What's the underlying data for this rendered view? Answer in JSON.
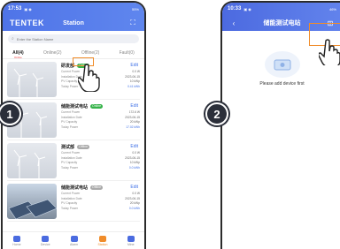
{
  "screen1": {
    "status_time": "17:53",
    "status_right": "55%",
    "logo": "TENTEK",
    "title": "Station",
    "search_placeholder": "Enter the Station Name",
    "tabs": [
      {
        "label": "All(4)",
        "sub": "Online"
      },
      {
        "label": "Online(2)"
      },
      {
        "label": "Offline(2)"
      },
      {
        "label": "Fault(0)"
      }
    ],
    "stations": [
      {
        "name": "研发部",
        "badge": "Online",
        "edit": "Edit",
        "rows": [
          [
            "Current Power",
            "0.0 W"
          ],
          [
            "Installation Date",
            "2023-06-15"
          ],
          [
            "PV Capacity",
            "10 kWp"
          ],
          [
            "Today Power",
            "0.41 kWh"
          ]
        ]
      },
      {
        "name": "储能测试电站",
        "badge": "Online",
        "edit": "Edit",
        "rows": [
          [
            "Current Power",
            "172.6 W"
          ],
          [
            "Installation Date",
            "2023-06-15"
          ],
          [
            "PV Capacity",
            "20 kWp"
          ],
          [
            "Today Power",
            "17.02 kWh"
          ]
        ]
      },
      {
        "name": "测试部",
        "badge": "Offline",
        "edit": "Edit",
        "rows": [
          [
            "Current Power",
            "0.0 W"
          ],
          [
            "Installation Date",
            "2023-06-15"
          ],
          [
            "PV Capacity",
            "10 kWp"
          ],
          [
            "Today Power",
            "0.0 kWh"
          ]
        ]
      },
      {
        "name": "储能测试电站",
        "badge": "Offline",
        "edit": "Edit",
        "rows": [
          [
            "Current Power",
            "0.0 W"
          ],
          [
            "Installation Date",
            "2023-06-15"
          ],
          [
            "PV Capacity",
            "20 kWp"
          ],
          [
            "Today Power",
            "0.0 kWh"
          ]
        ]
      }
    ],
    "nav": [
      "Home",
      "Device",
      "Alarm",
      "Station",
      "Mine"
    ]
  },
  "screen2": {
    "status_time": "10:33",
    "status_right": "46%",
    "title": "储能测试电站",
    "empty_text": "Please add device first"
  },
  "steps": [
    "1",
    "2"
  ],
  "colors": {
    "primary": "#4f74e8",
    "online": "#36b34a",
    "offline": "#aaaaaa",
    "accent": "#f08c2a",
    "link": "#3d6fe6"
  }
}
